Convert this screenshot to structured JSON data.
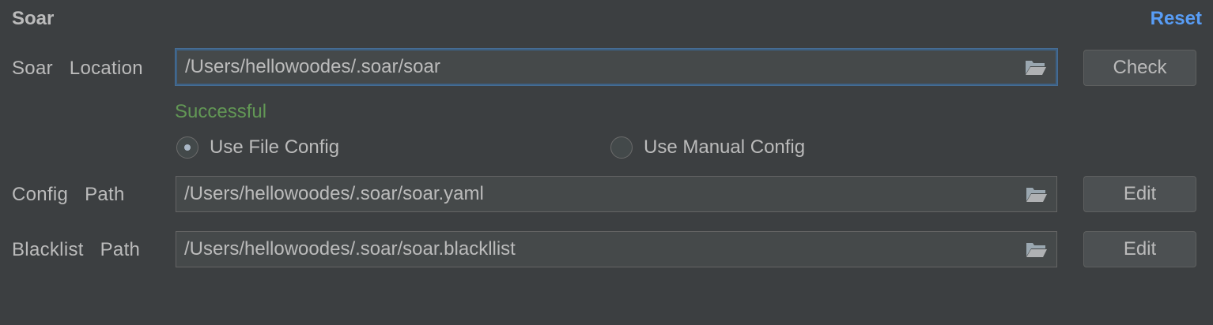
{
  "header": {
    "title": "Soar",
    "reset_label": "Reset"
  },
  "location": {
    "label": "Soar   Location",
    "value": "/Users/hellowoodes/.soar/soar",
    "button_label": "Check",
    "status": "Successful"
  },
  "config_mode": {
    "options": [
      {
        "label": "Use File Config",
        "selected": true
      },
      {
        "label": "Use Manual Config",
        "selected": false
      }
    ]
  },
  "config_path": {
    "label": "Config   Path",
    "value": "/Users/hellowoodes/.soar/soar.yaml",
    "button_label": "Edit"
  },
  "blacklist_path": {
    "label": "Blacklist   Path",
    "value": "/Users/hellowoodes/.soar/soar.blackllist",
    "button_label": "Edit"
  },
  "icons": {
    "browse": "folder-open-icon"
  },
  "colors": {
    "background": "#3c3f41",
    "link": "#589df6",
    "success": "#629755",
    "focus_border": "#3d6185"
  }
}
